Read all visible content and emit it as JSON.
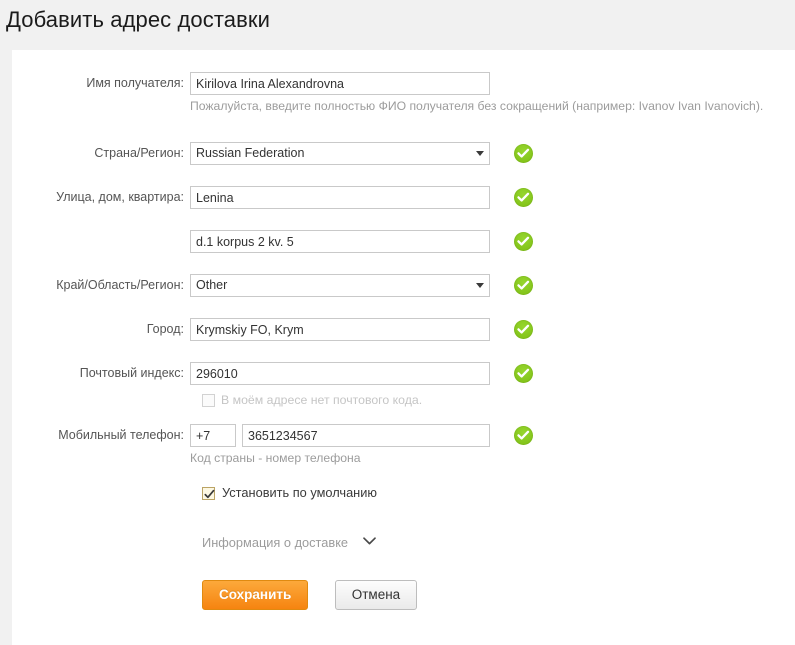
{
  "header": {
    "title": "Добавить адрес доставки"
  },
  "form": {
    "recipient": {
      "label": "Имя получателя:",
      "value": "Kirilova Irina Alexandrovna",
      "placeholder": "",
      "hint": "Пожалуйста, введите полностью ФИО получателя без сокращений (например: Ivanov Ivan Ivanovich)."
    },
    "country": {
      "label": "Страна/Регион:",
      "value": "Russian Federation",
      "valid_icon": "valid-check-icon",
      "caret_icon": "chevron-down-icon"
    },
    "street": {
      "label": "Улица, дом, квартира:",
      "value": "Lenina",
      "placeholder": "",
      "valid_icon": "valid-check-icon"
    },
    "street2": {
      "label": "",
      "value": "d.1 korpus 2 kv. 5",
      "placeholder": "",
      "valid_icon": "valid-check-icon"
    },
    "region": {
      "label": "Край/Область/Регион:",
      "value": "Other",
      "valid_icon": "valid-check-icon",
      "caret_icon": "chevron-down-icon"
    },
    "city": {
      "label": "Город:",
      "value": "Krymskiy FO, Krym",
      "placeholder": "",
      "valid_icon": "valid-check-icon"
    },
    "zip": {
      "label": "Почтовый индекс:",
      "value": "296010",
      "placeholder": "",
      "valid_icon": "valid-check-icon",
      "no_zip_checkbox_label": "В моём адресе нет почтового кода.",
      "no_zip_checked": false
    },
    "phone": {
      "label": "Мобильный телефон:",
      "country_code": "+7",
      "number": "3651234567",
      "hint": "Код страны - номер телефона",
      "valid_icon": "valid-check-icon"
    },
    "default_address": {
      "label": "Установить по умолчанию",
      "checked": true
    },
    "delivery_info": {
      "label": "Информация о доставке",
      "chevron_icon": "chevron-down-icon"
    }
  },
  "actions": {
    "save_label": "Сохранить",
    "cancel_label": "Отмена"
  },
  "colors": {
    "page_background": "#f1f1f1",
    "card_background": "#ffffff",
    "accent_orange": "#f79520",
    "valid_green": "#84c41b",
    "label_gray": "#555555",
    "hint_gray": "#9c9c9c"
  }
}
